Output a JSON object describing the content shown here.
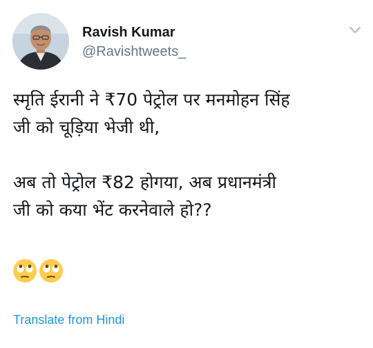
{
  "author": {
    "name": "Ravish Kumar",
    "handle": "@Ravishtweets_"
  },
  "tweet": {
    "lines": [
      "स्मृति ईरानी ने ₹70 पेट्रोल पर मनमोहन सिंह",
      "जी को चूड़िया भेजी थी,",
      "अब तो पेट्रोल ₹82 होगया, अब प्रधानमंत्री",
      "जी को कया भेंट करनेवाले हो??"
    ],
    "emojis": [
      "face-with-rolling-eyes-icon",
      "face-with-rolling-eyes-icon"
    ]
  },
  "translate": {
    "label": "Translate from Hindi"
  },
  "colors": {
    "link": "#1b95e0",
    "secondary_text": "#657786",
    "primary_text": "#14171a",
    "emoji_face": "#ffcc4d"
  },
  "icons": {
    "menu": "chevron-down-icon",
    "avatar": "avatar"
  }
}
